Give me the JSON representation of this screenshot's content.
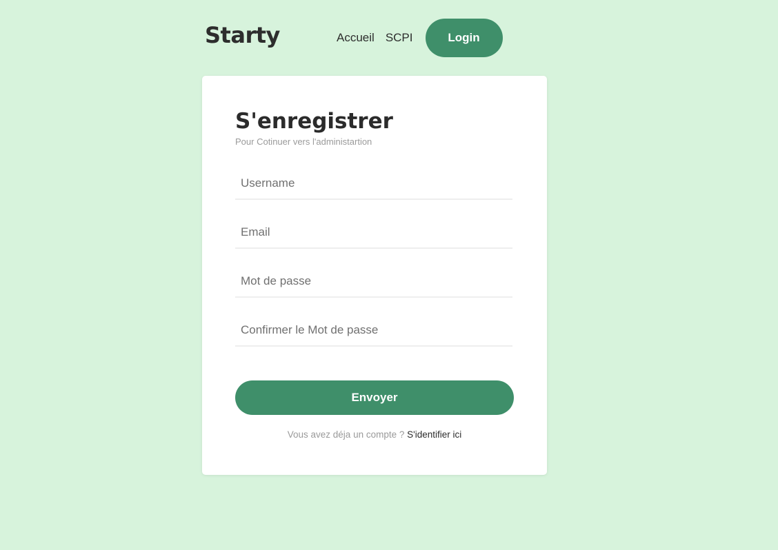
{
  "navbar": {
    "logo": "Starty",
    "links": [
      "Accueil",
      "SCPI"
    ],
    "login_label": "Login"
  },
  "form": {
    "title": "S'enregistrer",
    "subtitle": "Pour Cotinuer vers l'administartion",
    "fields": {
      "username_placeholder": "Username",
      "email_placeholder": "Email",
      "password_placeholder": "Mot de passe",
      "confirm_password_placeholder": "Confirmer le Mot de passe"
    },
    "submit_label": "Envoyer",
    "footer_text": "Vous avez déja un compte ?",
    "footer_link": "S'identifier ici"
  },
  "colors": {
    "background": "#d7f3dc",
    "accent": "#3f8f6a",
    "card": "#ffffff"
  }
}
